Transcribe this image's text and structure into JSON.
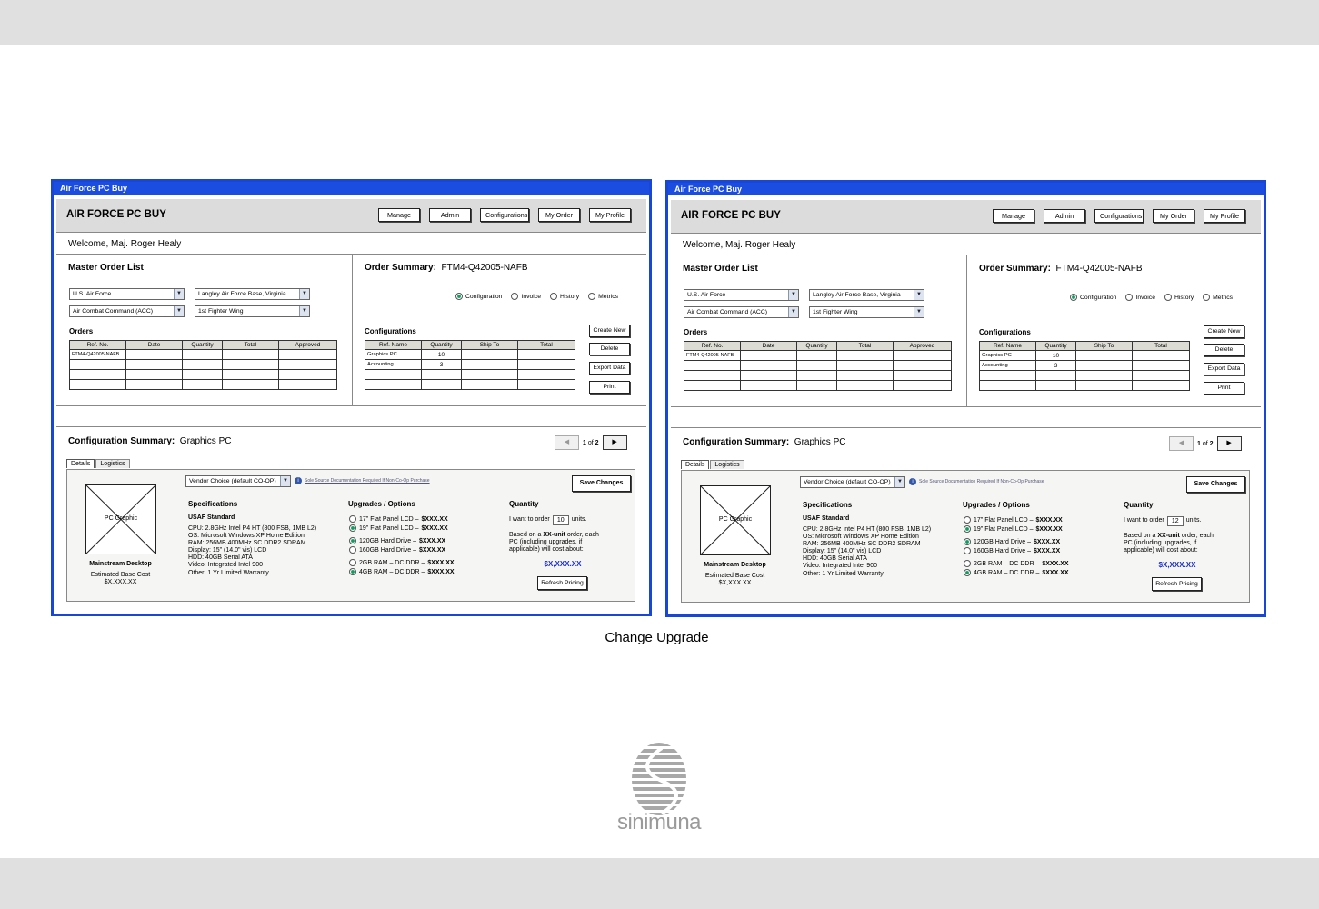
{
  "caption": "Change Upgrade",
  "logo": {
    "text": "sinimuna"
  },
  "screens": [
    {
      "window_title": "Air Force PC Buy",
      "app_title": "AIR FORCE PC BUY",
      "nav": [
        "Manage",
        "Admin",
        "Configurations",
        "My Order",
        "My Profile"
      ],
      "welcome": "Welcome, Maj. Roger Healy",
      "master": {
        "title": "Master Order List",
        "branch": "U.S. Air Force",
        "base": "Langley Air Force Base, Virginia",
        "command": "Air Combat Command (ACC)",
        "wing": "1st  Fighter Wing",
        "orders_label": "Orders",
        "columns": [
          "Ref. No.",
          "Date",
          "Quantity",
          "Total",
          "Approved"
        ],
        "rows": [
          [
            "FTM4-Q42005-NAFB",
            "",
            "",
            "",
            ""
          ]
        ]
      },
      "summary": {
        "title": "Order Summary:",
        "id": "FTM4-Q42005-NAFB",
        "views": [
          "Configuration",
          "Invoice",
          "History",
          "Metrics"
        ],
        "selected_view": "Configuration",
        "config_label": "Configurations",
        "columns": [
          "Ref. Name",
          "Quantity",
          "Ship To",
          "Total"
        ],
        "rows": [
          [
            "Graphics PC",
            "10",
            "",
            ""
          ],
          [
            "Accounting",
            "3",
            "",
            ""
          ]
        ],
        "buttons": [
          "Create New",
          "Delete",
          "Export Data",
          "Print"
        ]
      },
      "config": {
        "title": "Configuration Summary:",
        "name": "Graphics PC",
        "page": "1",
        "of": "of",
        "pages": "2",
        "tabs": [
          "Details",
          "Logistics"
        ],
        "vendor": "Vendor Choice (default CO-OP)",
        "doc_note": "Sole Source Documentation Required If Non-Co-Op Purchase",
        "save": "Save Changes",
        "graphic": "PC Graphic",
        "product": "Mainstream Desktop",
        "base_cost_label": "Estimated Base Cost",
        "base_cost": "$X,XXX.XX",
        "spec_title": "Specifications",
        "spec_name": "USAF Standard",
        "specs": [
          "CPU: 2.8GHz Intel P4 HT (800 FSB, 1MB L2)",
          "OS: Microsoft Windows XP Home Edition",
          "RAM: 256MB 400MHz SC DDR2 SDRAM",
          "Display: 15\" (14.0\" vis) LCD",
          "HDD: 40GB Serial ATA",
          "Video: Integrated Intel 900",
          "Other: 1 Yr Limited Warranty"
        ],
        "upg_title": "Upgrades / Options",
        "upgrades": [
          {
            "label": "17\" Flat Panel LCD –",
            "price": "$XXX.XX",
            "on": false
          },
          {
            "label": "19\" Flat Panel LCD –",
            "price": "$XXX.XX",
            "on": true
          },
          {
            "label": "120GB Hard Drive –",
            "price": "$XXX.XX",
            "on": true
          },
          {
            "label": "160GB Hard Drive –",
            "price": "$XXX.XX",
            "on": false
          },
          {
            "label": "2GB RAM – DC DDR –",
            "price": "$XXX.XX",
            "on": false
          },
          {
            "label": "4GB RAM – DC DDR –",
            "price": "$XXX.XX",
            "on": true
          }
        ],
        "qty_title": "Quantity",
        "qty_pre": "I want to order",
        "qty": "10",
        "qty_post": "units.",
        "based1": "Based on a",
        "based_bold": "XX-unit",
        "based2": "order, each",
        "based3": "PC (including upgrades, if",
        "based4": "applicable) will cost about:",
        "total": "$X,XXX.XX",
        "refresh": "Refresh Pricing"
      }
    },
    {
      "window_title": "Air Force PC Buy",
      "app_title": "AIR FORCE PC BUY",
      "nav": [
        "Manage",
        "Admin",
        "Configurations",
        "My Order",
        "My Profile"
      ],
      "welcome": "Welcome, Maj. Roger Healy",
      "master": {
        "title": "Master Order List",
        "branch": "U.S. Air Force",
        "base": "Langley Air Force Base, Virginia",
        "command": "Air Combat Command (ACC)",
        "wing": "1st  Fighter Wing",
        "orders_label": "Orders",
        "columns": [
          "Ref. No.",
          "Date",
          "Quantity",
          "Total",
          "Approved"
        ],
        "rows": [
          [
            "FTM4-Q42005-NAFB",
            "",
            "",
            "",
            ""
          ]
        ]
      },
      "summary": {
        "title": "Order Summary:",
        "id": "FTM4-Q42005-NAFB",
        "views": [
          "Configuration",
          "Invoice",
          "History",
          "Metrics"
        ],
        "selected_view": "Configuration",
        "config_label": "Configurations",
        "columns": [
          "Ref. Name",
          "Quantity",
          "Ship To",
          "Total"
        ],
        "rows": [
          [
            "Graphics PC",
            "10",
            "",
            ""
          ],
          [
            "Accounting",
            "3",
            "",
            ""
          ]
        ],
        "buttons": [
          "Create New",
          "Delete",
          "Export Data",
          "Print"
        ]
      },
      "config": {
        "title": "Configuration Summary:",
        "name": "Graphics PC",
        "page": "1",
        "of": "of",
        "pages": "2",
        "tabs": [
          "Details",
          "Logistics"
        ],
        "vendor": "Vendor Choice (default CO-OP)",
        "doc_note": "Sole Source Documentation Required If Non-Co-Op Purchase",
        "save": "Save Changes",
        "graphic": "PC Graphic",
        "product": "Mainstream Desktop",
        "base_cost_label": "Estimated Base Cost",
        "base_cost": "$X,XXX.XX",
        "spec_title": "Specifications",
        "spec_name": "USAF Standard",
        "specs": [
          "CPU: 2.8GHz Intel P4 HT (800 FSB, 1MB L2)",
          "OS: Microsoft Windows XP Home Edition",
          "RAM: 256MB 400MHz SC DDR2 SDRAM",
          "Display: 15\" (14.0\" vis) LCD",
          "HDD: 40GB Serial ATA",
          "Video: Integrated Intel 900",
          "Other: 1 Yr Limited Warranty"
        ],
        "upg_title": "Upgrades / Options",
        "upgrades": [
          {
            "label": "17\" Flat Panel LCD –",
            "price": "$XXX.XX",
            "on": false
          },
          {
            "label": "19\" Flat Panel LCD –",
            "price": "$XXX.XX",
            "on": true
          },
          {
            "label": "120GB Hard Drive –",
            "price": "$XXX.XX",
            "on": true
          },
          {
            "label": "160GB Hard Drive –",
            "price": "$XXX.XX",
            "on": false
          },
          {
            "label": "2GB RAM – DC DDR –",
            "price": "$XXX.XX",
            "on": false
          },
          {
            "label": "4GB RAM – DC DDR –",
            "price": "$XXX.XX",
            "on": true
          }
        ],
        "qty_title": "Quantity",
        "qty_pre": "I want to order",
        "qty": "12",
        "qty_post": "units.",
        "based1": "Based on a",
        "based_bold": "XX-unit",
        "based2": "order, each",
        "based3": "PC (including upgrades, if",
        "based4": "applicable) will cost about:",
        "total": "$X,XXX.XX",
        "refresh": "Refresh Pricing"
      }
    }
  ]
}
